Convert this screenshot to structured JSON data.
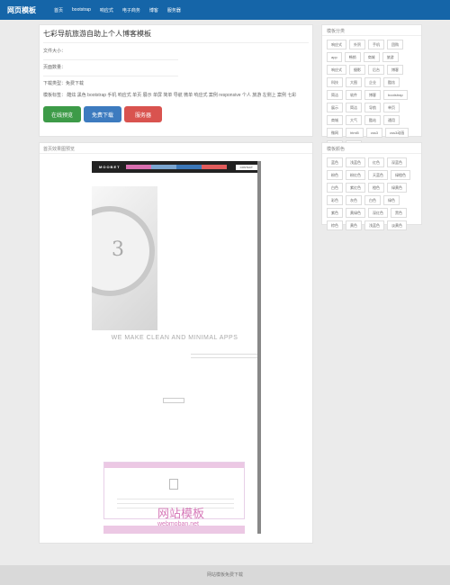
{
  "brand": "网页模板",
  "nav": [
    "首页",
    "bootstrap",
    "响应式",
    "电子商务",
    "博客",
    "服务器"
  ],
  "detail": {
    "title": "七彩导航旅游自助上个人博客模板",
    "file_size": "文件大小：",
    "page_count": "页面数量：",
    "download_type": "下载类型：免费下载",
    "tags": "模板标签：  酷炫  黑色  bootstrap  手机  响应式  单页  展示  单屏  简单  导航  微单  响应式  案例  responsive  个人  旅游  左侧上  案例  七彩",
    "buttons": {
      "preview": "在线预览",
      "download": "免费下载",
      "service": "服务器"
    }
  },
  "preview": {
    "title": "首页效果图预览",
    "shot_logo": "MOOBET",
    "shot_contact": "CONTACT",
    "hero_text": "WE MAKE CLEAN AND MINIMAL APPS",
    "watch_number": "3",
    "watermark_main": "网站模板",
    "watermark_sub": "webmoban.net",
    "menu_colors": [
      "#d96fb0",
      "#7aa5d0",
      "#3b77b8",
      "#e25c5c"
    ]
  },
  "sidebar": {
    "category": {
      "title": "模板分类",
      "tags": [
        "响应式",
        "外贸",
        "手机",
        "团购",
        "app",
        "畅销",
        "商城",
        "旅游",
        "响应式",
        "摄影",
        "后台",
        "博客",
        "科技",
        "大图",
        "企业",
        "酷炫",
        "简洁",
        "软件",
        "博客",
        "bootstrap",
        "展示",
        "简洁",
        "导航",
        "单页",
        "商城",
        "大气",
        "酷站",
        "通用",
        "微网",
        "html5",
        "css3",
        "css3动画",
        "扁平",
        "精品"
      ]
    },
    "color": {
      "title": "模板颜色",
      "tags": [
        "蓝色",
        "浅蓝色",
        "红色",
        "深蓝色",
        "粉色",
        "粉红色",
        "天蓝色",
        "绿橙色",
        "白色",
        "紫红色",
        "橙色",
        "绿黄色",
        "彩色",
        "灰色",
        "白色",
        "绿色",
        "紫色",
        "黄绿色",
        "深红色",
        "黑色",
        "棕色",
        "黄色",
        "浅蓝色",
        "淡黄色"
      ]
    }
  },
  "footer": "网站模板免费下载"
}
